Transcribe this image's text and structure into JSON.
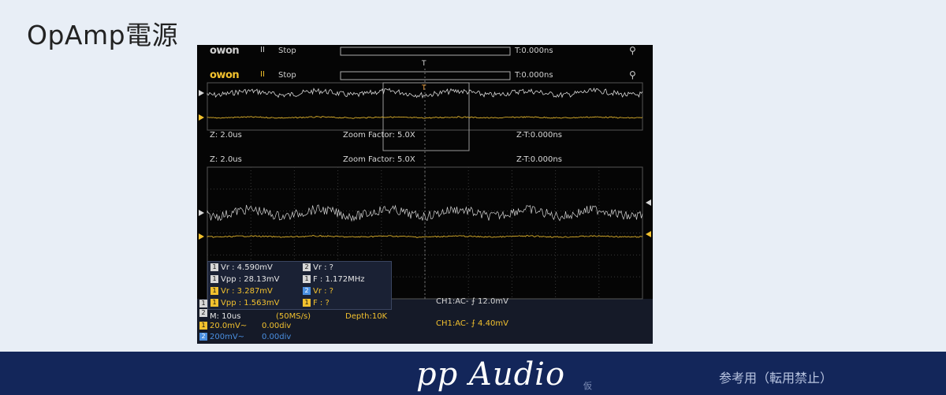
{
  "slide": {
    "title": "OpAmp電源",
    "brand": "pp Audio",
    "brand_sub": "仮",
    "notice": "参考用（転用禁止）"
  },
  "scope": {
    "logo": "owon",
    "pause_icon": "pause-icon",
    "status": "Stop",
    "trigger_pos": "T:0.000ns",
    "usb_icon": "usb-icon",
    "zoom_left": "Z: 2.0us",
    "zoom_factor": "Zoom Factor: 5.0X",
    "zoom_time": "Z-T:0.000ns",
    "colors": {
      "ch1": "#f2c12e",
      "ch2": "#d6d6d6",
      "grid": "#3a3a3a",
      "panel": "#1a2134"
    },
    "measurements": [
      {
        "ch": "1",
        "text": "Vr : 4.590mV",
        "ch2": "2",
        "text2": "Vr :    ?"
      },
      {
        "ch": "1",
        "text": "Vpp : 28.13mV",
        "ch2": "1",
        "text2": "F : 1.172MHz"
      },
      {
        "ch": "1",
        "text": "Vr : 3.287mV",
        "ch2": "2",
        "text2": "Vr :    ?"
      },
      {
        "ch": "1",
        "text": "Vpp : 1.563mV",
        "ch2": "1",
        "text2": "F :   ?"
      }
    ],
    "bottom": {
      "timebase": "M: 10us",
      "sample": "(50MS/s)",
      "depth": "Depth:10K",
      "trig_top": "CH1:AC- ⨍ 12.0mV",
      "trig_bottom": "CH1:AC- ⨍ 4.40mV",
      "ch1_scale": "20.0mV~",
      "ch1_offset": "0.00div",
      "ch2_scale": "200mV~",
      "ch2_offset": "0.00div",
      "ch_tag1": "1",
      "ch_tag2": "2"
    }
  }
}
